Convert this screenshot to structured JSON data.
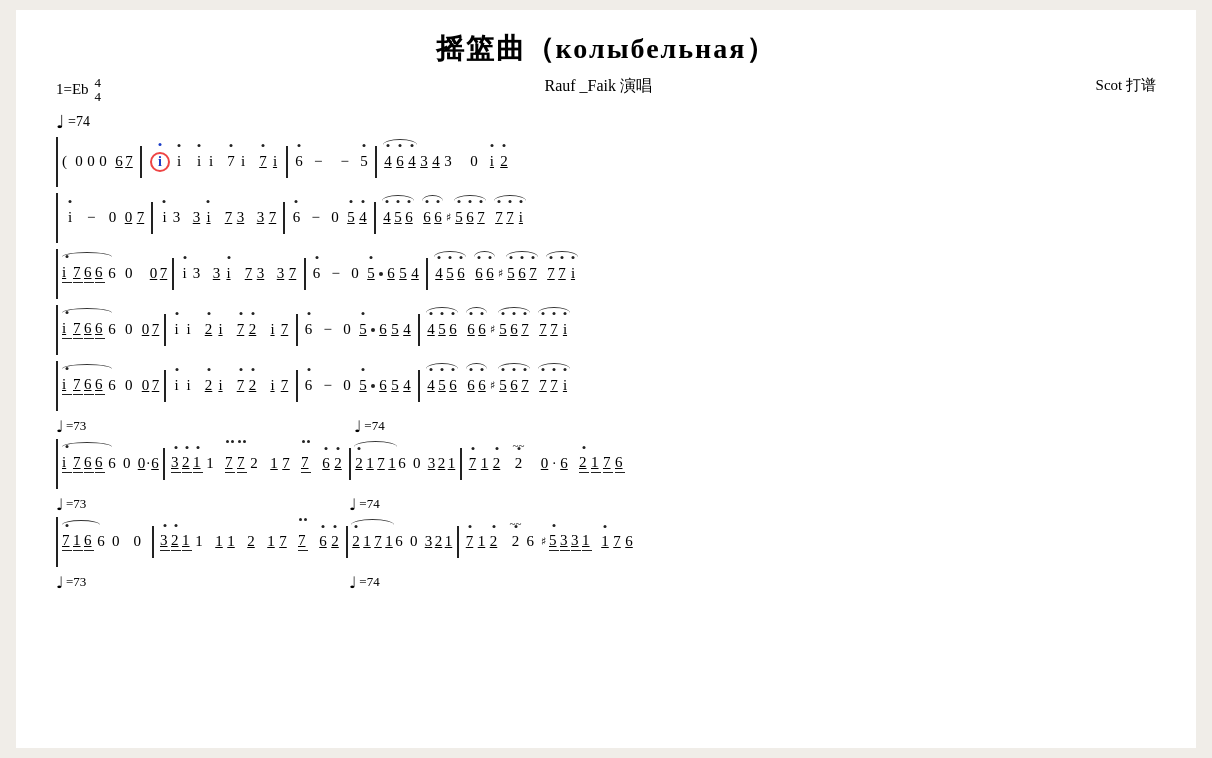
{
  "page": {
    "title": "摇篮曲（колыбельная）",
    "performer": "Rauf _Faik 演唱",
    "arranger": "Scot 打谱",
    "key": "1=Eb",
    "time_sig_top": "4",
    "time_sig_bottom": "4",
    "tempo1": "♩=74",
    "rows": []
  }
}
